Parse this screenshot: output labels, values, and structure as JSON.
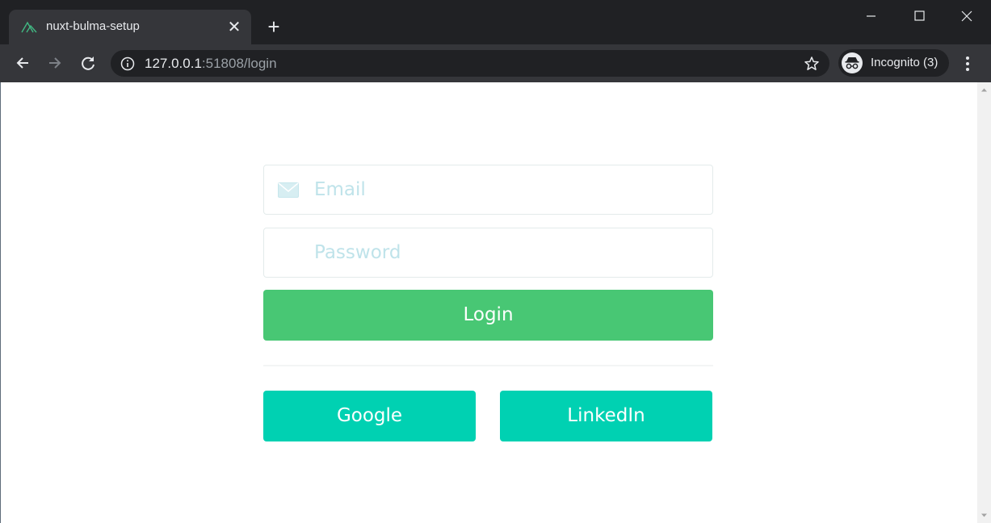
{
  "browser": {
    "tab_title": "nuxt-bulma-setup",
    "tab_close": "✕",
    "new_tab": "+",
    "url_host": "127.0.0.1",
    "url_rest": ":51808/login",
    "incognito_label": "Incognito (3)",
    "icons": [
      "nuxt-favicon-icon",
      "close-icon",
      "plus-icon",
      "minimize-icon",
      "maximize-icon",
      "window-close-icon",
      "back-arrow-icon",
      "forward-arrow-icon",
      "reload-icon",
      "info-icon",
      "star-icon",
      "incognito-icon",
      "kebab-menu-icon"
    ]
  },
  "login_form": {
    "email_placeholder": "Email",
    "password_placeholder": "Password",
    "login_label": "Login",
    "google_label": "Google",
    "linkedin_label": "LinkedIn"
  },
  "colors": {
    "success": "#48c774",
    "primary": "#00d1b2",
    "placeholder": "#bfe3ea",
    "chrome_dark": "#202124",
    "chrome_tab": "#35363a"
  }
}
